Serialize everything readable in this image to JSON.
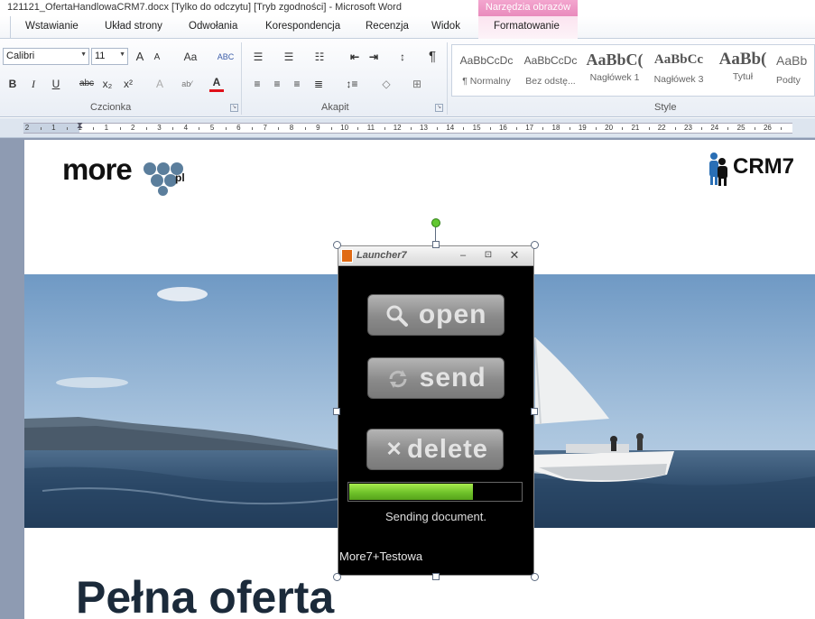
{
  "window": {
    "title": "121121_OfertaHandlowaCRM7.docx [Tylko do odczytu] [Tryb zgodności]  -  Microsoft Word",
    "contextual_group": "Narzędzia obrazów"
  },
  "tabs": [
    {
      "label": "Wstawianie"
    },
    {
      "label": "Układ strony"
    },
    {
      "label": "Odwołania"
    },
    {
      "label": "Korespondencja"
    },
    {
      "label": "Recenzja"
    },
    {
      "label": "Widok"
    },
    {
      "label": "Formatowanie"
    }
  ],
  "ribbon": {
    "font": {
      "group_label": "Czcionka",
      "font_name": "Calibri",
      "font_size": "11",
      "grow_label": "A",
      "shrink_label": "A",
      "case_label": "Aa",
      "bold": "B",
      "italic": "I",
      "underline": "U",
      "strike": "abc",
      "subscript": "x₂",
      "superscript": "x²",
      "font_color": "A"
    },
    "paragraph": {
      "group_label": "Akapit",
      "show_marks": "¶"
    },
    "styles": {
      "group_label": "Style",
      "items": [
        {
          "sample": "AaBbCcDc",
          "name": "¶ Normalny"
        },
        {
          "sample": "AaBbCcDc",
          "name": "Bez odstę..."
        },
        {
          "sample": "AaBbC(",
          "name": "Nagłówek 1"
        },
        {
          "sample": "AaBbCc",
          "name": "Nagłówek 3"
        },
        {
          "sample": "AaBb(",
          "name": "Tytuł"
        },
        {
          "sample": "AaBb",
          "name": "Podty"
        }
      ]
    }
  },
  "ruler": {
    "labels": [
      "2",
      "1",
      "1",
      "1",
      "2",
      "3",
      "4",
      "5",
      "6",
      "7",
      "8",
      "9",
      "10",
      "11",
      "12",
      "13",
      "14",
      "15",
      "16",
      "17",
      "18",
      "19",
      "20",
      "21",
      "22",
      "23",
      "24",
      "25",
      "26"
    ]
  },
  "document": {
    "logo_more": "more",
    "logo_pl": "pl",
    "logo_crm": "CRM7",
    "heading": "Pełna oferta"
  },
  "launcher": {
    "title": "Launcher7",
    "buttons": {
      "open": "open",
      "send": "send",
      "delete": "delete"
    },
    "progress": 0.72,
    "status": "Sending document.",
    "footer": "More7+Testowa"
  },
  "colors": {
    "progress_green": "#6fc22a",
    "contextual_pink": "#e98bbd",
    "logo_dots": "#5b7e9c",
    "heading": "#1b2a3a"
  }
}
